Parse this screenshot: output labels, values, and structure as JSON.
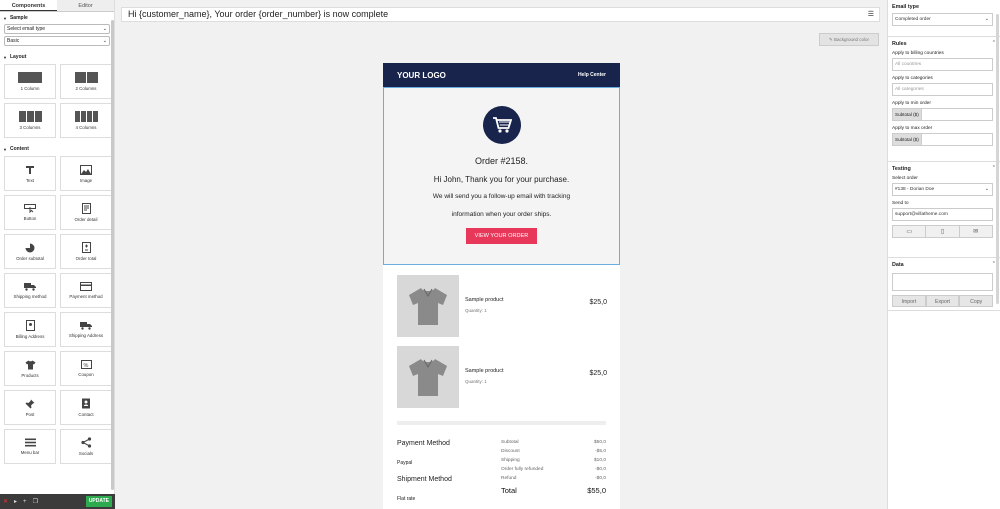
{
  "left": {
    "tabs": [
      "Components",
      "Editor"
    ],
    "sample": {
      "heading": "Sample",
      "email_type_select": "Select email type",
      "template_select": "Basic"
    },
    "layout": {
      "heading": "Layout",
      "items": [
        "1 Column",
        "2 Columns",
        "3 Columns",
        "4 Columns"
      ]
    },
    "content": {
      "heading": "Content",
      "items": [
        {
          "label": "Text",
          "icon": "text-icon"
        },
        {
          "label": "Image",
          "icon": "image-icon"
        },
        {
          "label": "Button",
          "icon": "button-icon"
        },
        {
          "label": "Order detail",
          "icon": "order-detail-icon"
        },
        {
          "label": "Order subtotal",
          "icon": "order-subtotal-icon"
        },
        {
          "label": "Order total",
          "icon": "order-total-icon"
        },
        {
          "label": "Shipping method",
          "icon": "truck-icon"
        },
        {
          "label": "Payment method",
          "icon": "credit-card-icon"
        },
        {
          "label": "Billing Address",
          "icon": "billing-address-icon"
        },
        {
          "label": "Shipping Address",
          "icon": "shipping-truck-icon"
        },
        {
          "label": "Products",
          "icon": "tshirt-icon"
        },
        {
          "label": "Coupon",
          "icon": "coupon-icon"
        },
        {
          "label": "Post",
          "icon": "pin-icon"
        },
        {
          "label": "Contact",
          "icon": "contact-book-icon"
        },
        {
          "label": "Menu bar",
          "icon": "menu-bars-icon"
        },
        {
          "label": "Socials",
          "icon": "share-icon"
        }
      ]
    },
    "bottom": {
      "update_label": "UPDATE"
    }
  },
  "subject": "Hi {customer_name}, Your order {order_number} is now complete",
  "bg_button": "Background color",
  "email": {
    "logo": "YOUR LOGO",
    "help": "Help Center",
    "order_no": "Order #2158.",
    "greeting": "Hi John, Thank you for your purchase.",
    "message_line1": "We will send you a follow-up email with tracking",
    "message_line2": "information when your order ships.",
    "cta": "VIEW YOUR ORDER",
    "products": [
      {
        "name": "Sample product",
        "qty": "Quantity: 1",
        "price": "$25,0"
      },
      {
        "name": "Sample product",
        "qty": "Quantity: 1",
        "price": "$25,0"
      }
    ],
    "payment_method_label": "Payment Method",
    "payment_method_value": "Paypal",
    "shipment_method_label": "Shipment Method",
    "shipment_method_value": "Flat rate",
    "totals": [
      {
        "label": "Subtotal",
        "value": "$50,0"
      },
      {
        "label": "Discount",
        "value": "-$5,0"
      },
      {
        "label": "Shipping",
        "value": "$10,0"
      },
      {
        "label": "Order fully refunded",
        "value": "-$0,0"
      },
      {
        "label": "Refund",
        "value": "-$0,0"
      }
    ],
    "total": {
      "label": "Total",
      "value": "$55,0"
    },
    "colors": {
      "header": "#18244b",
      "cta": "#e8385a"
    }
  },
  "right": {
    "email_type": {
      "heading": "Email type",
      "value": "Completed order"
    },
    "rules": {
      "heading": "Rules",
      "billing_label": "Apply to billing countries",
      "billing_placeholder": "All countries",
      "categories_label": "Apply to categories",
      "categories_placeholder": "All categories",
      "min_label": "Apply to min order",
      "max_label": "Apply to max order",
      "addon": "Subtotal ($)"
    },
    "testing": {
      "heading": "Testing",
      "select_order_label": "Select order",
      "order_value": "#138 - Dorian Doe",
      "send_to_label": "Send to",
      "send_to_value": "support@villatheme.com"
    },
    "data": {
      "heading": "Data",
      "buttons": [
        "Import",
        "Export",
        "Copy"
      ]
    }
  }
}
